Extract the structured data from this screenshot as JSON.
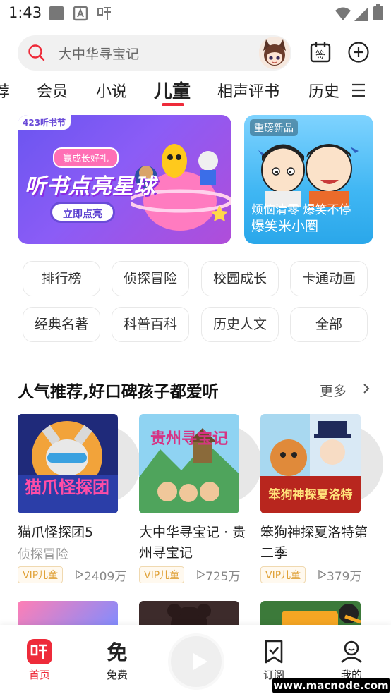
{
  "status_bar": {
    "time": "1:43",
    "notification_icons": [
      "square-icon",
      "a-box-icon",
      "ting-icon"
    ],
    "system_icons": [
      "wifi-icon",
      "signal-icon",
      "battery-icon"
    ]
  },
  "search": {
    "placeholder": "大中华寻宝记"
  },
  "header_icons": {
    "checkin_label": "签",
    "add": "plus-circle-icon"
  },
  "tabs": [
    "荐",
    "会员",
    "小说",
    "儿童",
    "相声评书",
    "历史"
  ],
  "active_tab": "儿童",
  "banners": {
    "left": {
      "tag": "423听书节",
      "subtitle": "赢成长好礼",
      "title": "听书点亮星球",
      "button": "立即点亮"
    },
    "right": {
      "tag": "重磅新品",
      "line1": "烦恼清零 爆笑不停",
      "line2": "爆笑米小圈"
    }
  },
  "categories": [
    "排行榜",
    "侦探冒险",
    "校园成长",
    "卡通动画",
    "经典名著",
    "科普百科",
    "历史人文",
    "全部"
  ],
  "section": {
    "title": "人气推荐,好口碑孩子都爱听",
    "more": "更多"
  },
  "cards": [
    {
      "title": "猫爪怪探团5",
      "category": "侦探冒险",
      "badge": "VIP儿童",
      "plays": "2409万",
      "cover_text": "猫爪怪探团",
      "cover_color": "#2a3a9a"
    },
    {
      "title": "大中华寻宝记 · 贵州寻宝记",
      "category": "",
      "badge": "VIP儿童",
      "plays": "725万",
      "cover_text": "贵州寻宝记",
      "cover_color": "#5fb86a"
    },
    {
      "title": "笨狗神探夏洛特第二季",
      "category": "",
      "badge": "VIP儿童",
      "plays": "379万",
      "cover_text": "笨狗神探夏洛特",
      "cover_color": "#c0392b"
    }
  ],
  "nav": [
    {
      "label": "首页",
      "icon": "ting-home-icon",
      "active": true
    },
    {
      "label": "免费",
      "icon": "mian-free-icon"
    },
    {
      "label": "订阅",
      "icon": "bookmark-check-icon"
    },
    {
      "label": "我的",
      "icon": "profile-icon"
    }
  ],
  "watermark": "www.macnode.com",
  "colors": {
    "accent": "#ee2b3a",
    "vip": "#e0a239"
  }
}
